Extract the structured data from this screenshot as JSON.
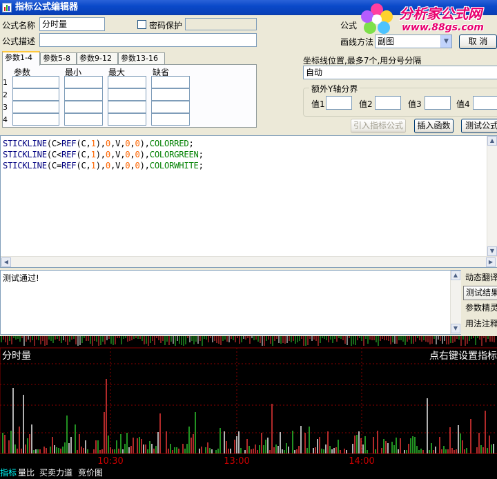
{
  "window": {
    "title": "指标公式编辑器"
  },
  "logo": {
    "brand": "分析家公式网",
    "url": "www.88gs.com"
  },
  "form": {
    "name_label": "公式名称",
    "name_value": "分时量",
    "password_label": "密码保护",
    "password_checked": false,
    "desc_label": "公式描述",
    "desc_value": "",
    "type_label": "公式",
    "draw_method_label": "画线方法",
    "draw_method_value": "副图",
    "cancel_button": "取 消"
  },
  "param_tabs": [
    "参数1-4",
    "参数5-8",
    "参数9-12",
    "参数13-16"
  ],
  "param_table": {
    "headers": [
      "参数",
      "最小",
      "最大",
      "缺省"
    ],
    "rows": [
      "1",
      "2",
      "3",
      "4"
    ]
  },
  "axis": {
    "label": "坐标线位置,最多7个,用分号分隔",
    "value": "自动",
    "extra_y_title": "额外Y轴分界",
    "values": [
      "值1",
      "值2",
      "值3",
      "值4"
    ]
  },
  "toolbar": {
    "import_formula": "引入指标公式",
    "insert_function": "插入函数",
    "test_formula": "测试公式"
  },
  "code_lines": [
    {
      "kw1": "STICKLINE",
      "cond": "C>",
      "kw2": "REF",
      "arg1": "C",
      "n1": "1",
      "v": "V",
      "n2": "0",
      "n3": "0",
      "color": "COLORRED"
    },
    {
      "kw1": "STICKLINE",
      "cond": "C<",
      "kw2": "REF",
      "arg1": "C",
      "n1": "1",
      "v": "V",
      "n2": "0",
      "n3": "0",
      "color": "COLORGREEN"
    },
    {
      "kw1": "STICKLINE",
      "cond": "C=",
      "kw2": "REF",
      "arg1": "C",
      "n1": "1",
      "v": "V",
      "n2": "0",
      "n3": "0",
      "color": "COLORWHITE"
    }
  ],
  "output": {
    "text": "测试通过!"
  },
  "side_buttons": [
    "动态翻译",
    "测试结果",
    "参数精灵",
    "用法注释"
  ],
  "chart": {
    "title": "分时量",
    "hint": "点右键设置指标",
    "time_labels": [
      "10:30",
      "13:00",
      "14:00"
    ],
    "colors": {
      "up": "#ff3c3c",
      "down": "#32d232",
      "flat": "#ffffff",
      "grid": "#8b0000",
      "axis_text": "#c80000"
    }
  },
  "bottom_tabs": [
    "指标",
    "量比",
    "买卖力道",
    "竞价图"
  ]
}
